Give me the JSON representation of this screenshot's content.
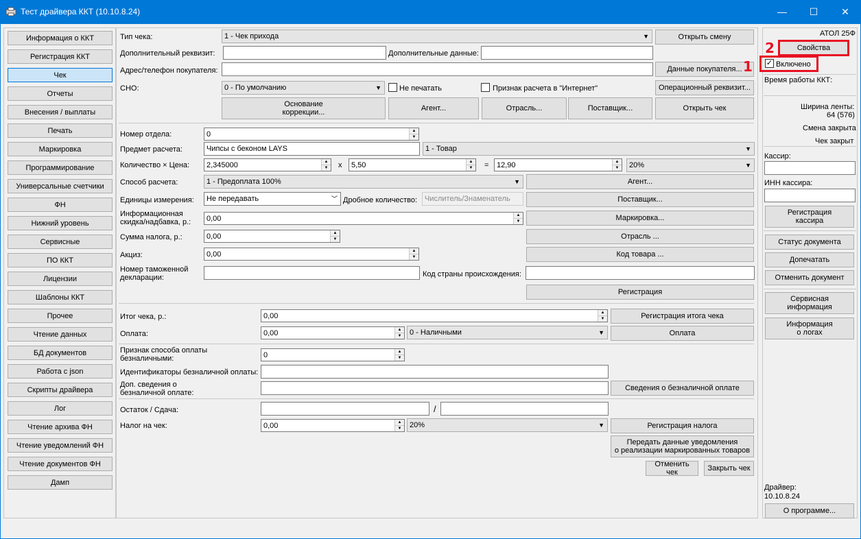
{
  "window": {
    "title": "Тест драйвера ККТ (10.10.8.24)",
    "minimize": "—",
    "maximize": "☐",
    "close": "✕"
  },
  "sidebar": {
    "items": [
      "Информация о ККТ",
      "Регистрация ККТ",
      "Чек",
      "Отчеты",
      "Внесения / выплаты",
      "Печать",
      "Маркировка",
      "Программирование",
      "Универсальные счетчики",
      "ФН",
      "Нижний уровень",
      "Сервисные",
      "ПО ККТ",
      "Лицензии",
      "Шаблоны ККТ",
      "Прочее",
      "Чтение данных",
      "БД документов",
      "Работа с json",
      "Скрипты драйвера",
      "Лог",
      "Чтение архива ФН",
      "Чтение уведомлений ФН",
      "Чтение документов ФН",
      "Дамп"
    ],
    "selected": "Чек"
  },
  "header": {
    "receipt_type_label": "Тип чека:",
    "receipt_type_value": "1 - Чек прихода",
    "open_shift": "Открыть смену",
    "extra_requisite_label": "Дополнительный реквизит:",
    "extra_requisite_value": "",
    "extra_data_label": "Дополнительные данные:",
    "extra_data_value": "",
    "buyer_contact_label": "Адрес/телефон покупателя:",
    "buyer_contact_value": "",
    "buyer_data_button": "Данные покупателя...",
    "sno_label": "СНО:",
    "sno_value": "0 - По умолчанию",
    "no_print_label": "Не печатать",
    "internet_label": "Признак расчета в \"Интернет\"",
    "operational_requisite": "Операционный реквизит...",
    "correction_basis": "Основание\nкоррекции...",
    "agent": "Агент...",
    "industry": "Отрасль...",
    "supplier": "Поставщик...",
    "open_receipt": "Открыть чек"
  },
  "item": {
    "department_label": "Номер отдела:",
    "department_value": "0",
    "subject_label": "Предмет расчета:",
    "subject_value": "Чипсы с беконом LAYS",
    "subject_type": "1 - Товар",
    "qty_price_label": "Количество × Цена:",
    "quantity": "2,345000",
    "times": "x",
    "price": "5,50",
    "equals": "=",
    "sum": "12,90",
    "vat": "20%",
    "payment_method_label": "Способ расчета:",
    "payment_method_value": "1 - Предоплата 100%",
    "agent_button": "Агент...",
    "units_label": "Единицы измерения:",
    "units_value": "Не передавать",
    "fraction_label": "Дробное количество:",
    "fraction_placeholder": "Числитель/Знаменатель",
    "supplier_button": "Поставщик...",
    "discount_label": "Информационная\nскидка/надбавка, р.:",
    "discount_value": "0,00",
    "marking_button": "Маркировка...",
    "tax_sum_label": "Сумма налога, р.:",
    "tax_sum_value": "0,00",
    "industry_button": "Отрасль ...",
    "excise_label": "Акциз:",
    "excise_value": "0,00",
    "product_code_button": "Код товара ...",
    "customs_label": "Номер таможенной\nдекларации:",
    "customs_value": "",
    "country_label": "Код страны происхождения:",
    "country_value": "",
    "registration_button": "Регистрация"
  },
  "totals": {
    "total_label": "Итог чека, р.:",
    "total_value": "0,00",
    "total_button": "Регистрация итога чека",
    "payment_label": "Оплата:",
    "payment_value": "0,00",
    "payment_type": "0 - Наличными",
    "payment_button": "Оплата",
    "cashless_sign_label": "Признак способа оплаты\nбезналичными:",
    "cashless_sign_value": "0",
    "cashless_ids_label": "Идентификаторы безналичной оплаты:",
    "cashless_ids_value": "",
    "cashless_extra_label": "Доп. сведения о\nбезналичной оплате:",
    "cashless_extra_value": "",
    "cashless_info_button": "Сведения о безналичной оплате",
    "change_label": "Остаток / Сдача:",
    "change_value1": "",
    "slash": "/",
    "change_value2": "",
    "receipt_tax_label": "Налог на чек:",
    "receipt_tax_value": "0,00",
    "receipt_tax_rate": "20%",
    "tax_register_button": "Регистрация налога",
    "notify_button": "Передать данные уведомления\nо реализации маркированных товаров",
    "cancel_receipt": "Отменить чек",
    "close_receipt": "Закрыть чек"
  },
  "right_panel": {
    "model": "АТОЛ 25Ф",
    "properties": "Свойства",
    "enabled_label": "Включено",
    "enabled_checked": "✓",
    "uptime_label": "Время работы ККТ:",
    "tape_width_label": "Ширина ленты:",
    "tape_width_value": "64 (576)",
    "shift_status": "Смена закрыта",
    "receipt_status": "Чек закрыт",
    "cashier_label": "Кассир:",
    "cashier_value": "",
    "cashier_inn_label": "ИНН кассира:",
    "cashier_inn_value": "",
    "cashier_register": "Регистрация\nкассира",
    "doc_status": "Статус документа",
    "reprint": "Допечатать",
    "cancel_doc": "Отменить документ",
    "service_info": "Сервисная\nинформация",
    "log_info": "Информация\nо логах",
    "driver_label": "Драйвер:",
    "driver_version": "10.10.8.24",
    "about": "О программе..."
  },
  "annotations": {
    "marker_1": "1",
    "marker_2": "2",
    "accent_color": "#e81123"
  }
}
